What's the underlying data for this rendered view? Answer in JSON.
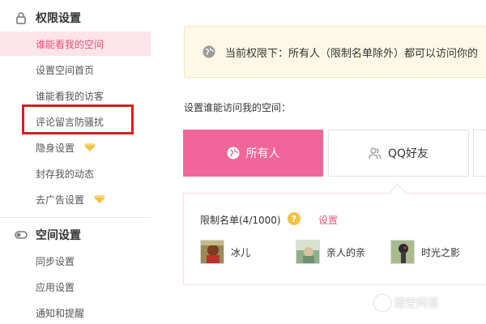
{
  "sidebar": {
    "section1_title": "权限设置",
    "section1_items": [
      {
        "label": "谁能看我的空间",
        "active": true
      },
      {
        "label": "设置空间首页"
      },
      {
        "label": "谁能看我的访客"
      },
      {
        "label": "评论留言防骚扰"
      },
      {
        "label": "隐身设置",
        "badge": "gem-icon"
      },
      {
        "label": "封存我的动态"
      },
      {
        "label": "去广告设置",
        "badge": "gem-icon"
      }
    ],
    "section2_title": "空间设置",
    "section2_items": [
      {
        "label": "同步设置"
      },
      {
        "label": "应用设置"
      },
      {
        "label": "通知和提醒"
      }
    ]
  },
  "main": {
    "notice": "当前权限下：所有人（限制名单除外）都可以访问你的",
    "who_label": "设置谁能访问我的空间：",
    "options": [
      {
        "label": "所有人",
        "icon": "globe-icon",
        "selected": true
      },
      {
        "label": "QQ好友",
        "icon": "friends-icon",
        "selected": false
      }
    ],
    "panel": {
      "limit_label": "限制名单(4/1000)",
      "help": "?",
      "settings_link": "设置",
      "friends": [
        {
          "name": "冰儿"
        },
        {
          "name": "亲人的亲"
        },
        {
          "name": "时光之影"
        }
      ]
    }
  },
  "watermark": "悟空问答",
  "colors": {
    "accent_pink": "#f0669a",
    "active_bg": "#fce4ea",
    "link_pink": "#e8537f",
    "notice_bg": "#fef9e6",
    "highlight_red": "#d81e1e",
    "gem_gold": "#f5c242"
  }
}
